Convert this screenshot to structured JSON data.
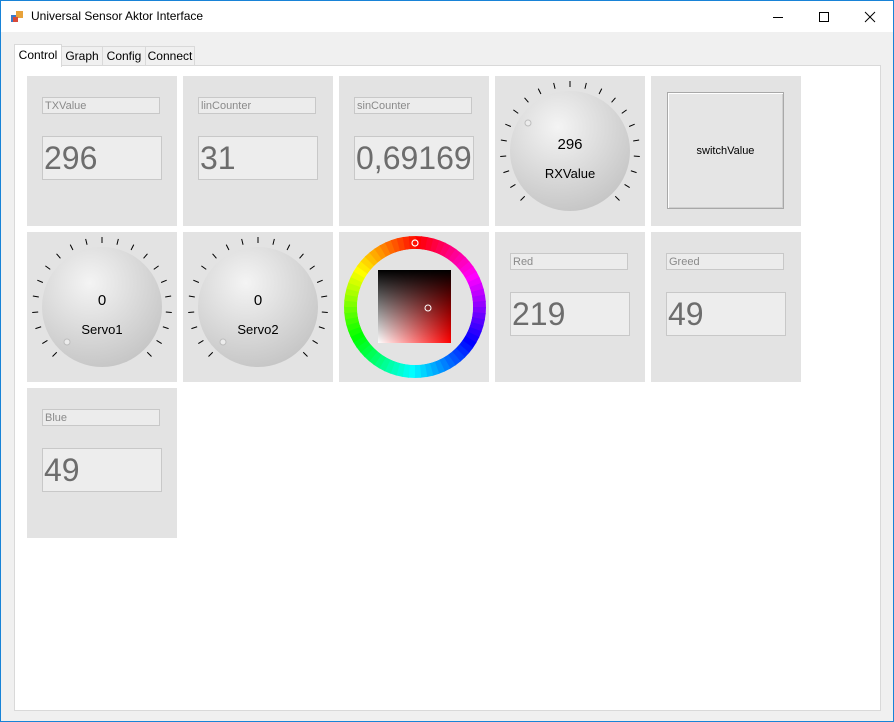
{
  "window": {
    "title": "Universal Sensor Aktor Interface"
  },
  "tabs": [
    "Control",
    "Graph",
    "Config",
    "Connect"
  ],
  "tiles": {
    "txvalue": {
      "label": "TXValue",
      "value": "296"
    },
    "lincounter": {
      "label": "linCounter",
      "value": "31"
    },
    "sincounter": {
      "label": "sinCounter",
      "value": "0,69169"
    },
    "rxvalue": {
      "label": "RXValue",
      "value": "296"
    },
    "switch": {
      "label": "switchValue"
    },
    "servo1": {
      "label": "Servo1",
      "value": "0"
    },
    "servo2": {
      "label": "Servo2",
      "value": "0"
    },
    "red": {
      "label": "Red",
      "value": "219"
    },
    "greed": {
      "label": "Greed",
      "value": "49"
    },
    "blue": {
      "label": "Blue",
      "value": "49"
    }
  },
  "colors": {
    "tile_bg": "#e3e3e3",
    "window_border": "#1883d7",
    "selected_color": "#db3131"
  }
}
